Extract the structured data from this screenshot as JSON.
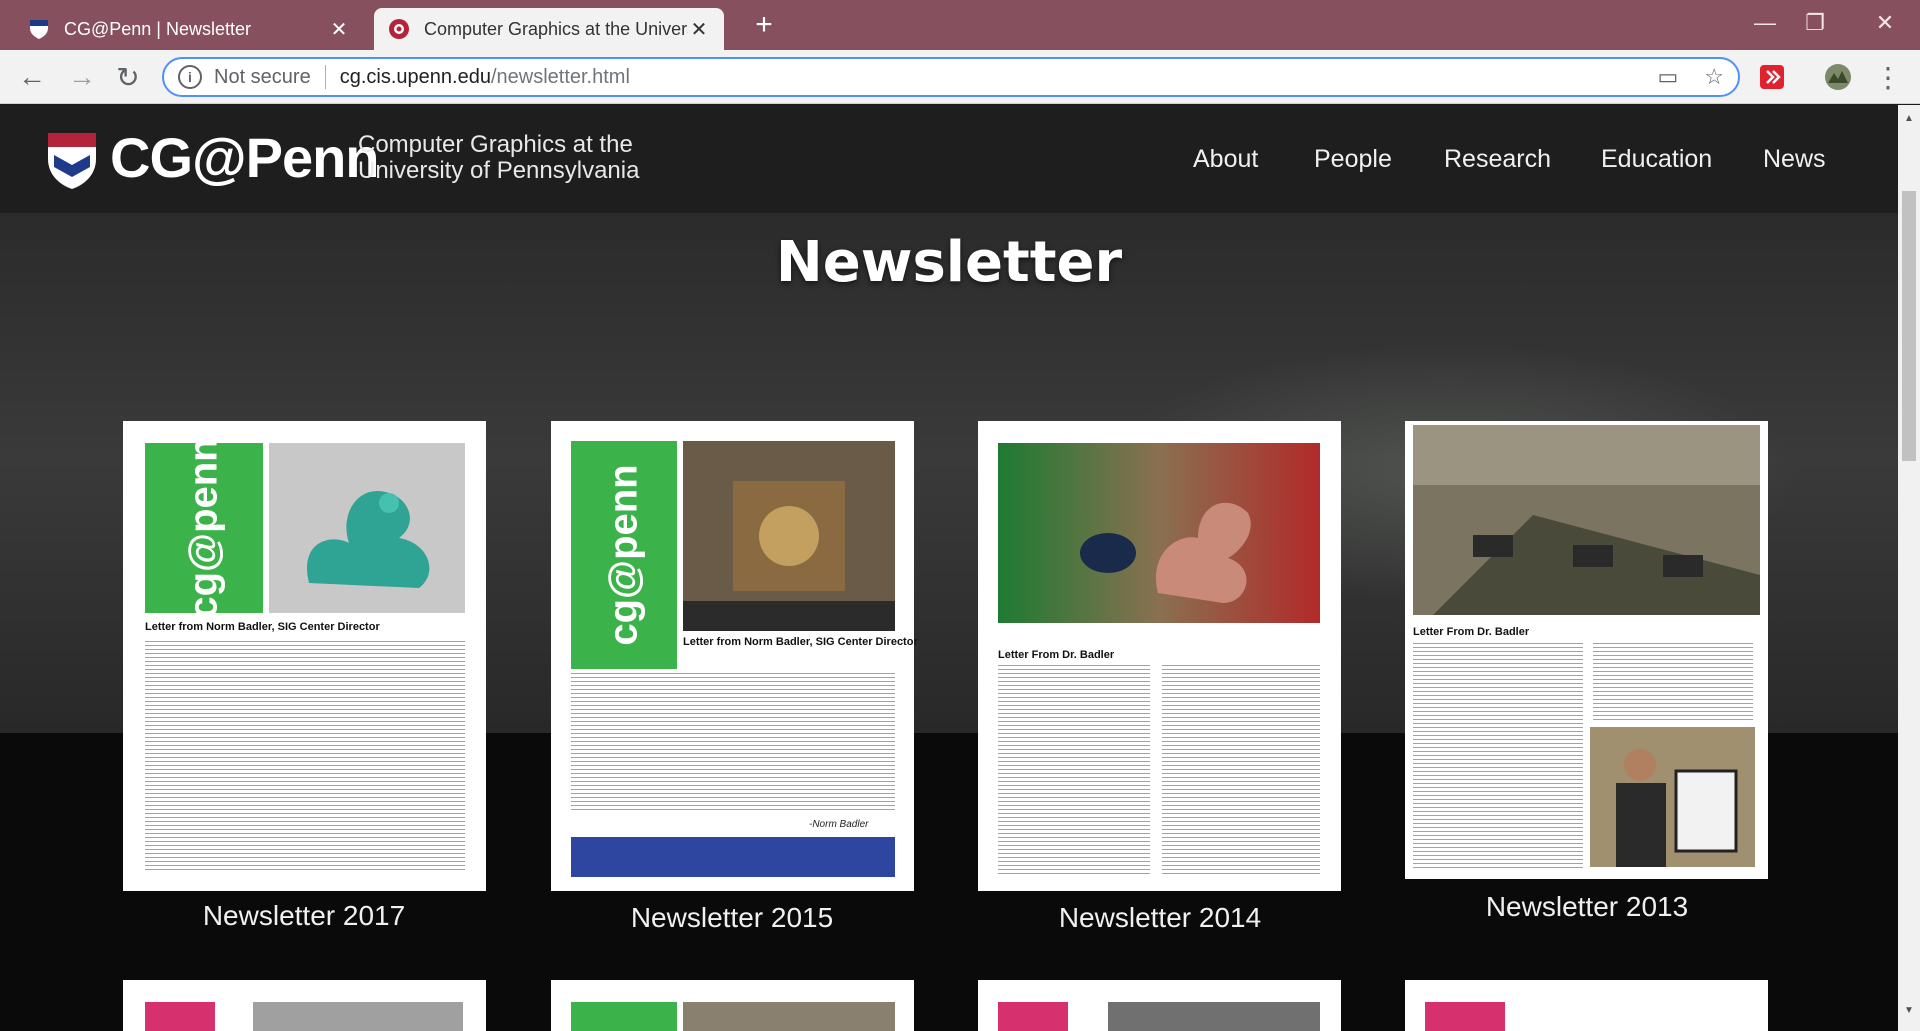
{
  "browser": {
    "tabs": [
      {
        "title": "CG@Penn | Newsletter",
        "active": false
      },
      {
        "title": "Computer Graphics at the University of Pennsylvania",
        "active": true
      }
    ],
    "close_glyph": "✕",
    "new_tab_glyph": "+",
    "security_label": "Not secure",
    "url_host": "cg.cis.upenn.edu",
    "url_path": "/newsletter.html"
  },
  "site": {
    "logo_text": "CG@Penn",
    "logo_sub_line1": "Computer Graphics at the",
    "logo_sub_line2": "University of Pennsylvania",
    "nav": [
      "About",
      "People",
      "Research",
      "Education",
      "News"
    ]
  },
  "page": {
    "title": "Newsletter",
    "newsletters": [
      {
        "caption": "Newsletter 2017",
        "heading": "Letter from Norm Badler, SIG Center Director"
      },
      {
        "caption": "Newsletter 2015",
        "heading": "Letter from Norm Badler, SIG Center Director"
      },
      {
        "caption": "Newsletter 2014",
        "heading": "Letter From Dr. Badler"
      },
      {
        "caption": "Newsletter 2013",
        "heading": "Letter From Dr. Badler"
      }
    ],
    "cover_brand": "cg@penn",
    "cover_2015_signature": "-Norm Badler"
  },
  "colors": {
    "titlebar": "#87505e",
    "accent_green": "#3cb34a",
    "accent_pink": "#d6306f",
    "banner_blue": "#2e46a0"
  }
}
